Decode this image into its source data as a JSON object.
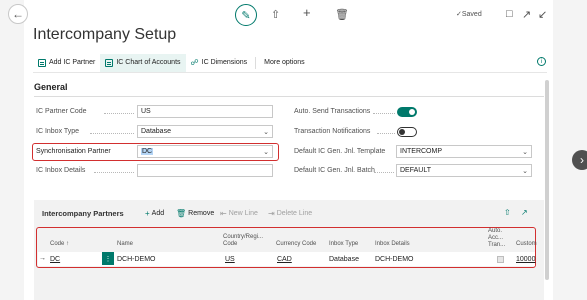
{
  "window": {
    "title": "Intercompany Setup"
  },
  "topbar": {
    "saved_label": "Saved"
  },
  "actions": {
    "add_ic_partner": "Add IC Partner",
    "ic_chart_of_accounts": "IC Chart of Accounts",
    "ic_dimensions": "IC Dimensions",
    "more_options": "More options"
  },
  "general": {
    "title": "General",
    "ic_partner_code": {
      "label": "IC Partner Code",
      "value": "US"
    },
    "ic_inbox_type": {
      "label": "IC Inbox Type",
      "value": "Database"
    },
    "synchronisation_partner": {
      "label": "Synchronisation Partner",
      "value": "DC"
    },
    "ic_inbox_details": {
      "label": "IC Inbox Details",
      "value": ""
    },
    "auto_send_transactions": {
      "label": "Auto. Send Transactions",
      "on": true
    },
    "transaction_notifications": {
      "label": "Transaction Notifications",
      "on": false
    },
    "default_template": {
      "label": "Default IC Gen. Jnl. Template",
      "value": "INTERCOMP"
    },
    "default_batch": {
      "label": "Default IC Gen. Jnl. Batch",
      "value": "DEFAULT"
    }
  },
  "partners": {
    "title": "Intercompany Partners",
    "add": "Add",
    "remove": "Remove",
    "new_line": "New Line",
    "delete_line": "Delete Line",
    "columns": {
      "code": "Code ↑",
      "name": "Name",
      "country": "Country/Regi... Code",
      "currency": "Currency Code",
      "inbox_type": "Inbox Type",
      "inbox_details": "Inbox Details",
      "auto_accept": "Auto. Acc... Tran...",
      "customer": "Custom"
    },
    "rows": [
      {
        "code": "DC",
        "name": "DCH-DEMO",
        "country": "US",
        "currency": "CAD",
        "inbox_type": "Database",
        "inbox_details": "DCH-DEMO",
        "auto_accept": false,
        "customer": "10000"
      }
    ]
  },
  "colors": {
    "accent": "#00796b",
    "highlight": "#d22f2f"
  }
}
